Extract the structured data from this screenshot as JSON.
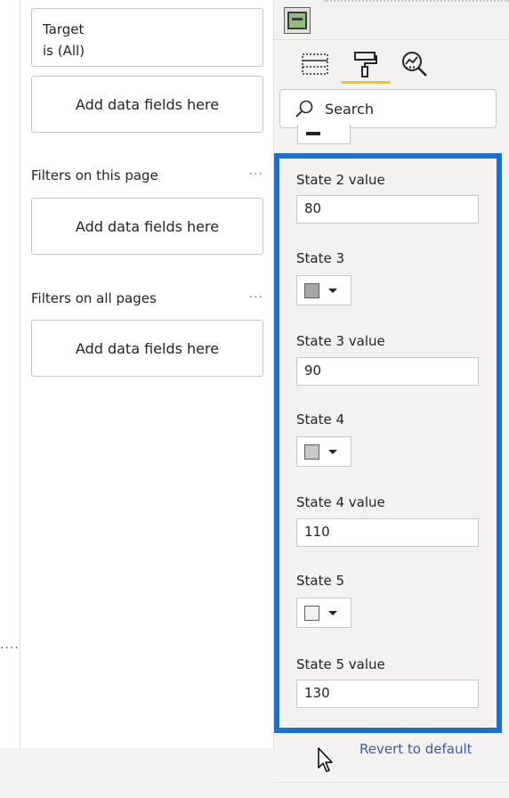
{
  "filters": {
    "target_card": {
      "line1": "Target",
      "line2": "is (All)"
    },
    "add_data_label": "Add data fields here",
    "sections": [
      {
        "title": "Filters on this page",
        "more": "···"
      },
      {
        "title": "Filters on all pages",
        "more": "···"
      }
    ]
  },
  "left_strip": {
    "dots": "····"
  },
  "format_pane": {
    "search_placeholder": "Search",
    "tabs": [
      "fields-icon",
      "format-paint-icon",
      "analytics-icon"
    ],
    "active_tab": "format-paint-icon",
    "accent_color": "#f2c811",
    "highlight_color": "#1a6fd1",
    "properties": [
      {
        "label": "State 2 value",
        "type": "number",
        "value": "80"
      },
      {
        "label": "State 3",
        "type": "color",
        "color": "#a6a6a6"
      },
      {
        "label": "State 3 value",
        "type": "number",
        "value": "90"
      },
      {
        "label": "State 4",
        "type": "color",
        "color": "#c8c8c8"
      },
      {
        "label": "State 4 value",
        "type": "number",
        "value": "110"
      },
      {
        "label": "State 5",
        "type": "color",
        "color": "#f2f2f2"
      },
      {
        "label": "State 5 value",
        "type": "number",
        "value": "130"
      }
    ],
    "revert_label": "Revert to default"
  }
}
